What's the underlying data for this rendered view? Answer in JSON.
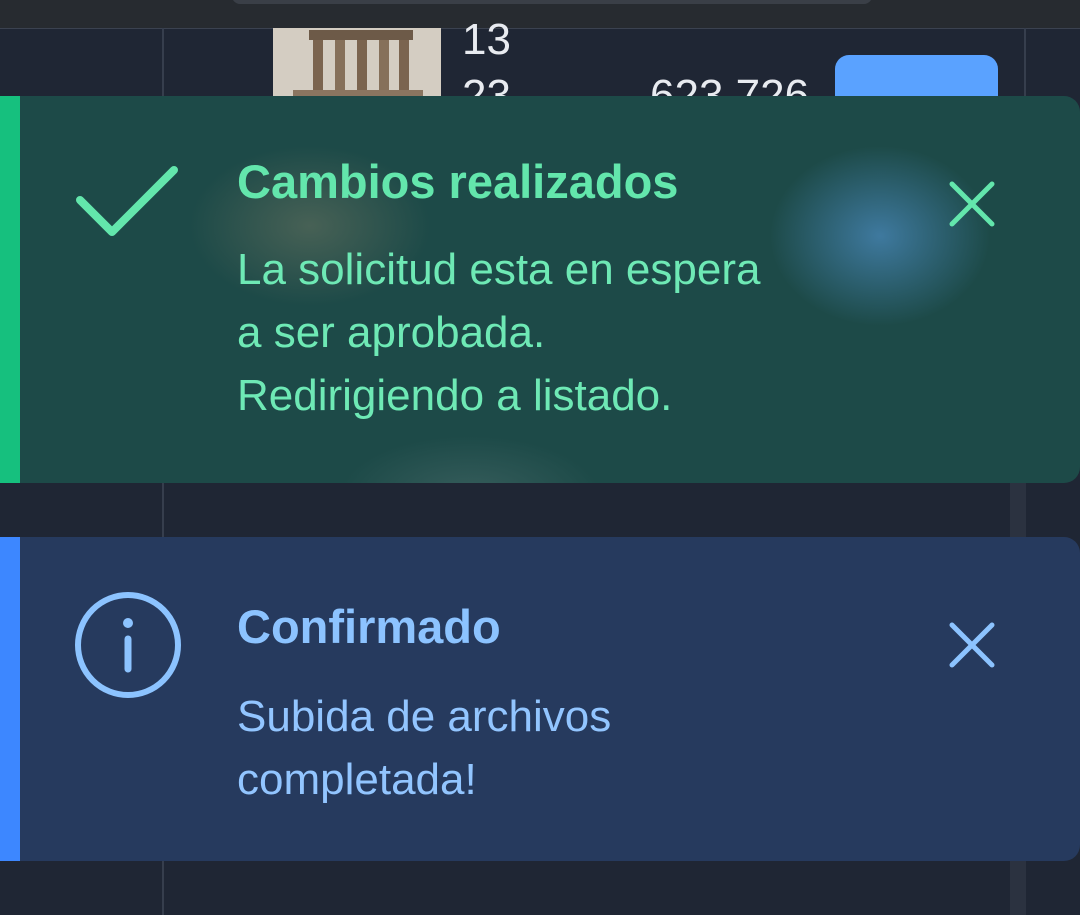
{
  "background_table": {
    "row_text_top": "13",
    "row_text_bottom_left": "23",
    "row_text_bottom_right": "623 726"
  },
  "colors": {
    "success_accent": "#16c07e",
    "success_text": "#63e6ac",
    "success_bg": "#1d4a48",
    "info_accent": "#3d87ff",
    "info_text": "#8cc3ff",
    "info_bg": "#263a5e",
    "page_bg": "#1f2634"
  },
  "toasts": [
    {
      "type": "success",
      "icon": "check-icon",
      "title": "Cambios realizados",
      "message_lines": [
        "La solicitud esta en espera",
        "a ser aprobada.",
        "Redirigiendo a listado."
      ],
      "close_icon": "close-icon"
    },
    {
      "type": "info",
      "icon": "info-icon",
      "title": "Confirmado",
      "message_lines": [
        "Subida de archivos",
        "completada!"
      ],
      "close_icon": "close-icon"
    }
  ]
}
